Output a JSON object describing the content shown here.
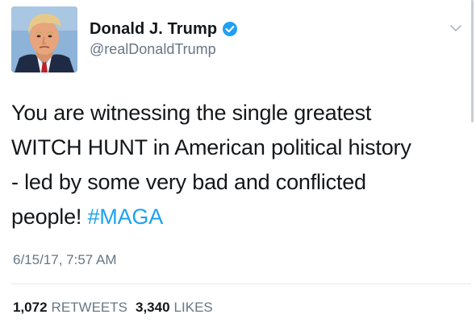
{
  "user": {
    "display_name": "Donald J. Trump",
    "handle": "@realDonaldTrump",
    "verified": true
  },
  "tweet": {
    "line1": "You are witnessing the single greatest",
    "line2": "WITCH HUNT in American political history",
    "line3": "- led by some very bad and conflicted",
    "line4_text": "people! ",
    "hashtag": "#MAGA",
    "timestamp": "6/15/17, 7:57 AM"
  },
  "stats": {
    "retweets_count": "1,072",
    "retweets_label": "RETWEETS",
    "likes_count": "3,340",
    "likes_label": "LIKES"
  },
  "icons": {
    "verified": "verified-badge-icon",
    "menu": "chevron-down-icon"
  },
  "colors": {
    "link": "#1da1f2",
    "secondary_text": "#657786",
    "primary_text": "#14171a"
  }
}
